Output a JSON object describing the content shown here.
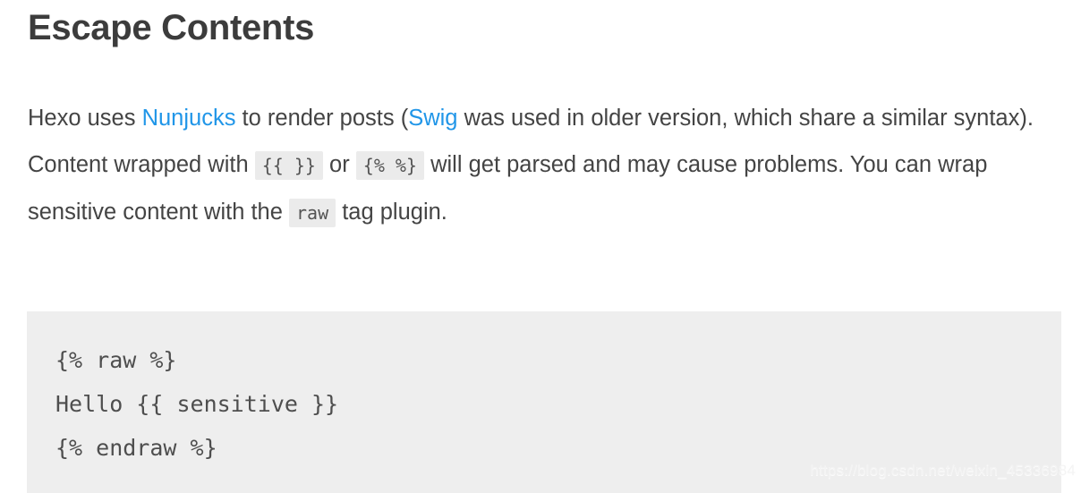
{
  "document": {
    "heading": "Escape Contents",
    "paragraph": {
      "segment_1": "Hexo uses ",
      "link_1": "Nunjucks",
      "segment_2": " to render posts (",
      "link_2": "Swig",
      "segment_3": " was used in older version, which share a similar syntax). Content wrapped with ",
      "code_1": "{{ }}",
      "segment_4": " or ",
      "code_2": "{% %}",
      "segment_5": " will get parsed and may cause problems. You can wrap sensitive content with the ",
      "code_3": "raw",
      "segment_6": " tag plugin."
    },
    "code_block": {
      "line_1": "{% raw %}",
      "line_2": "Hello {{ sensitive }}",
      "line_3": "{% endraw %}"
    },
    "watermark": "https://blog.csdn.net/weixin_45336984"
  },
  "colors": {
    "link": "#2196e8",
    "heading": "#3c3c3c",
    "body_text": "#444444",
    "inline_code_bg": "#ebebeb",
    "code_block_bg": "#eeeeee",
    "code_text": "#4e4e4e",
    "page_bg": "#ffffff"
  }
}
